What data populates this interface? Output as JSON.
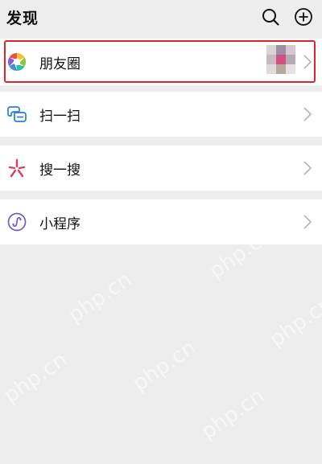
{
  "header": {
    "title": "发现",
    "search_icon": "search-icon",
    "add_icon": "add-circle-icon"
  },
  "items": [
    {
      "label": "朋友圈",
      "icon": "moments-aperture-icon",
      "highlighted": true,
      "has_thumbnail": true
    },
    {
      "label": "扫一扫",
      "icon": "scan-icon"
    },
    {
      "label": "搜一搜",
      "icon": "search-star-icon"
    },
    {
      "label": "小程序",
      "icon": "mini-program-icon"
    }
  ],
  "colors": {
    "background": "#ededed",
    "row": "#ffffff",
    "highlight": "#e0242e",
    "scan_icon": "#2b7fd4",
    "search_star_icon": "#e03c5a",
    "mini_program_icon": "#6b5fc7",
    "chevron": "#b2b2b2"
  },
  "watermark": "php.cn"
}
